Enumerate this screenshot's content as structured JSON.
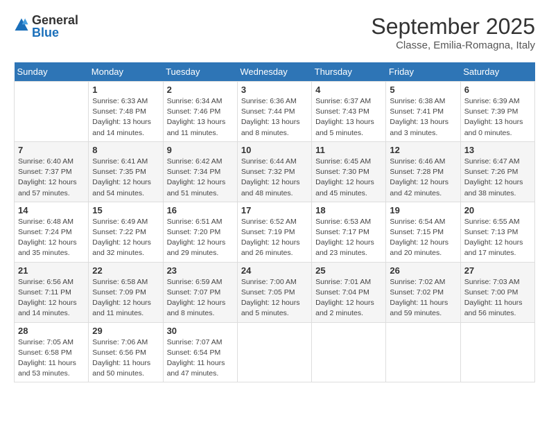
{
  "header": {
    "logo_general": "General",
    "logo_blue": "Blue",
    "month_title": "September 2025",
    "location": "Classe, Emilia-Romagna, Italy"
  },
  "weekdays": [
    "Sunday",
    "Monday",
    "Tuesday",
    "Wednesday",
    "Thursday",
    "Friday",
    "Saturday"
  ],
  "weeks": [
    [
      {
        "day": "",
        "info": ""
      },
      {
        "day": "1",
        "info": "Sunrise: 6:33 AM\nSunset: 7:48 PM\nDaylight: 13 hours\nand 14 minutes."
      },
      {
        "day": "2",
        "info": "Sunrise: 6:34 AM\nSunset: 7:46 PM\nDaylight: 13 hours\nand 11 minutes."
      },
      {
        "day": "3",
        "info": "Sunrise: 6:36 AM\nSunset: 7:44 PM\nDaylight: 13 hours\nand 8 minutes."
      },
      {
        "day": "4",
        "info": "Sunrise: 6:37 AM\nSunset: 7:43 PM\nDaylight: 13 hours\nand 5 minutes."
      },
      {
        "day": "5",
        "info": "Sunrise: 6:38 AM\nSunset: 7:41 PM\nDaylight: 13 hours\nand 3 minutes."
      },
      {
        "day": "6",
        "info": "Sunrise: 6:39 AM\nSunset: 7:39 PM\nDaylight: 13 hours\nand 0 minutes."
      }
    ],
    [
      {
        "day": "7",
        "info": "Sunrise: 6:40 AM\nSunset: 7:37 PM\nDaylight: 12 hours\nand 57 minutes."
      },
      {
        "day": "8",
        "info": "Sunrise: 6:41 AM\nSunset: 7:35 PM\nDaylight: 12 hours\nand 54 minutes."
      },
      {
        "day": "9",
        "info": "Sunrise: 6:42 AM\nSunset: 7:34 PM\nDaylight: 12 hours\nand 51 minutes."
      },
      {
        "day": "10",
        "info": "Sunrise: 6:44 AM\nSunset: 7:32 PM\nDaylight: 12 hours\nand 48 minutes."
      },
      {
        "day": "11",
        "info": "Sunrise: 6:45 AM\nSunset: 7:30 PM\nDaylight: 12 hours\nand 45 minutes."
      },
      {
        "day": "12",
        "info": "Sunrise: 6:46 AM\nSunset: 7:28 PM\nDaylight: 12 hours\nand 42 minutes."
      },
      {
        "day": "13",
        "info": "Sunrise: 6:47 AM\nSunset: 7:26 PM\nDaylight: 12 hours\nand 38 minutes."
      }
    ],
    [
      {
        "day": "14",
        "info": "Sunrise: 6:48 AM\nSunset: 7:24 PM\nDaylight: 12 hours\nand 35 minutes."
      },
      {
        "day": "15",
        "info": "Sunrise: 6:49 AM\nSunset: 7:22 PM\nDaylight: 12 hours\nand 32 minutes."
      },
      {
        "day": "16",
        "info": "Sunrise: 6:51 AM\nSunset: 7:20 PM\nDaylight: 12 hours\nand 29 minutes."
      },
      {
        "day": "17",
        "info": "Sunrise: 6:52 AM\nSunset: 7:19 PM\nDaylight: 12 hours\nand 26 minutes."
      },
      {
        "day": "18",
        "info": "Sunrise: 6:53 AM\nSunset: 7:17 PM\nDaylight: 12 hours\nand 23 minutes."
      },
      {
        "day": "19",
        "info": "Sunrise: 6:54 AM\nSunset: 7:15 PM\nDaylight: 12 hours\nand 20 minutes."
      },
      {
        "day": "20",
        "info": "Sunrise: 6:55 AM\nSunset: 7:13 PM\nDaylight: 12 hours\nand 17 minutes."
      }
    ],
    [
      {
        "day": "21",
        "info": "Sunrise: 6:56 AM\nSunset: 7:11 PM\nDaylight: 12 hours\nand 14 minutes."
      },
      {
        "day": "22",
        "info": "Sunrise: 6:58 AM\nSunset: 7:09 PM\nDaylight: 12 hours\nand 11 minutes."
      },
      {
        "day": "23",
        "info": "Sunrise: 6:59 AM\nSunset: 7:07 PM\nDaylight: 12 hours\nand 8 minutes."
      },
      {
        "day": "24",
        "info": "Sunrise: 7:00 AM\nSunset: 7:05 PM\nDaylight: 12 hours\nand 5 minutes."
      },
      {
        "day": "25",
        "info": "Sunrise: 7:01 AM\nSunset: 7:04 PM\nDaylight: 12 hours\nand 2 minutes."
      },
      {
        "day": "26",
        "info": "Sunrise: 7:02 AM\nSunset: 7:02 PM\nDaylight: 11 hours\nand 59 minutes."
      },
      {
        "day": "27",
        "info": "Sunrise: 7:03 AM\nSunset: 7:00 PM\nDaylight: 11 hours\nand 56 minutes."
      }
    ],
    [
      {
        "day": "28",
        "info": "Sunrise: 7:05 AM\nSunset: 6:58 PM\nDaylight: 11 hours\nand 53 minutes."
      },
      {
        "day": "29",
        "info": "Sunrise: 7:06 AM\nSunset: 6:56 PM\nDaylight: 11 hours\nand 50 minutes."
      },
      {
        "day": "30",
        "info": "Sunrise: 7:07 AM\nSunset: 6:54 PM\nDaylight: 11 hours\nand 47 minutes."
      },
      {
        "day": "",
        "info": ""
      },
      {
        "day": "",
        "info": ""
      },
      {
        "day": "",
        "info": ""
      },
      {
        "day": "",
        "info": ""
      }
    ]
  ]
}
